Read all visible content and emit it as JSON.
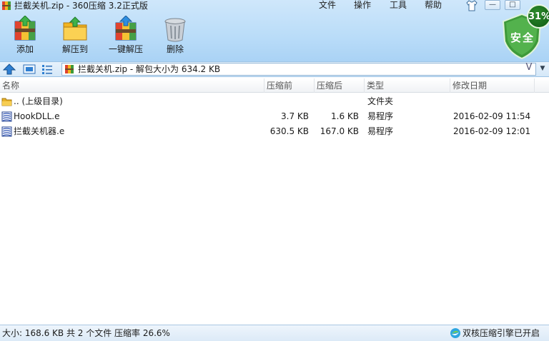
{
  "window": {
    "title": "拦截关机.zip - 360压缩 3.2正式版",
    "controls": {
      "minimize": "—",
      "maximize": "□"
    }
  },
  "menu": [
    "文件",
    "操作",
    "工具",
    "帮助"
  ],
  "toolbar": [
    {
      "label": "添加",
      "icon": "add-archive-icon"
    },
    {
      "label": "解压到",
      "icon": "extract-folder-icon"
    },
    {
      "label": "一键解压",
      "icon": "one-click-extract-icon"
    },
    {
      "label": "删除",
      "icon": "trash-can-icon"
    }
  ],
  "security": {
    "label": "安全",
    "percent": "31%"
  },
  "address": {
    "path": "拦截关机.zip - 解包大小为 634.2 KB",
    "dropdown": "V"
  },
  "columns": [
    "名称",
    "压缩前",
    "压缩后",
    "类型",
    "修改日期"
  ],
  "rows": [
    {
      "name": ".. (上级目录)",
      "before": "",
      "after": "",
      "type": "文件夹",
      "date": "",
      "icon": "folder-icon"
    },
    {
      "name": "HookDLL.e",
      "before": "3.7 KB",
      "after": "1.6 KB",
      "type": "易程序",
      "date": "2016-02-09 11:54",
      "icon": "e-file-icon"
    },
    {
      "name": "拦截关机器.e",
      "before": "630.5 KB",
      "after": "167.0 KB",
      "type": "易程序",
      "date": "2016-02-09 12:01",
      "icon": "e-file-icon"
    }
  ],
  "status": {
    "summary": "大小: 168.6 KB 共 2 个文件 压缩率 26.6%",
    "core": "双核压缩引擎已开启"
  },
  "colors": {
    "toolbar_top": "#cfe7fb",
    "toolbar_bottom": "#a9d2f5",
    "shield": "#3e9a3a"
  }
}
